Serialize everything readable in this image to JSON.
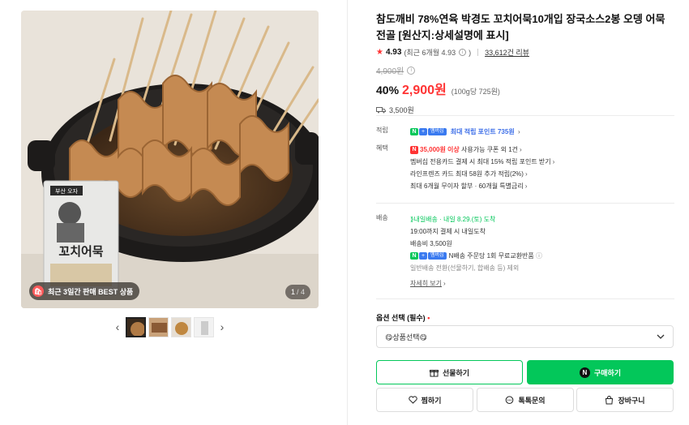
{
  "gallery": {
    "best_badge": "최근 3일간 판매 BEST 상품",
    "counter_current": "1",
    "counter_total": "/ 4",
    "package_top": "부산  오자",
    "package_title": "꼬치어묵",
    "thumbnail_count": 4
  },
  "product": {
    "title": "참도깨비 78%연육 박경도 꼬치어묵10개입 장국소스2봉 오뎅 어묵전골 [원산지:상세설명에 표시]",
    "rating_score": "4.93",
    "rating_recent": "(최근 6개월 4.93",
    "rating_recent_end": ")",
    "review_count": "33,612건 리뷰",
    "original_price": "4,900원",
    "discount": "40%",
    "price": "2,900원",
    "unit_price": "(100g당 725원)",
    "shipping_fee_short": "3,500원"
  },
  "benefits": {
    "points_label": "적립",
    "points_badge": "멤버십",
    "points_text": "최대 적립 포인트 735원",
    "perks_label": "혜택",
    "perk1_highlight": "35,000원 이상",
    "perk1_rest": " 사용가능 쿠폰 외 1건",
    "perk2": "멤버십 전용카드 결제 시 최대 15% 적립 포인트 받기",
    "perk3": "라인프렌즈 카드 최대 58원 추가 적립(2%)",
    "perk4": "최대 6개월 무이자 할부 · 60개월 특별금리"
  },
  "delivery": {
    "label": "배송",
    "type": "내일배송",
    "date": " · 내일 8.29.(토) 도착",
    "cutoff": "19:00까지 결제 시 내일도착",
    "fee": "배송비 3,500원",
    "badge": "멤버십",
    "return_text": "N배송 주문당 1회 무료교환반품",
    "exclusion": "일반배송 전환(선물하기, 합배송 등) 제외",
    "more": "자세히 보기"
  },
  "option": {
    "label": "옵션 선택 (필수)",
    "required_mark": "•",
    "select_value": "😋상품선택😋"
  },
  "actions": {
    "gift": "선물하기",
    "buy": "구매하기",
    "wish": "찜하기",
    "talk": "톡톡문의",
    "cart": "장바구니"
  },
  "colors": {
    "accent_green": "#03c75a",
    "price_red": "#ff3333",
    "link_blue": "#3c6ee8"
  }
}
